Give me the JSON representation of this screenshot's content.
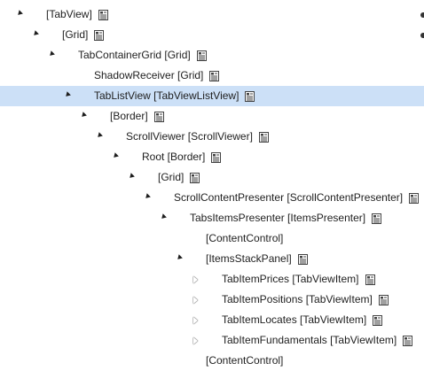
{
  "tree": {
    "nodes": [
      {
        "label": "[TabView]",
        "depth": 0,
        "expander": "expanded",
        "icon": "document-icon"
      },
      {
        "label": "[Grid]",
        "depth": 1,
        "expander": "expanded",
        "icon": "document-icon"
      },
      {
        "label": "TabContainerGrid [Grid]",
        "depth": 2,
        "expander": "expanded",
        "icon": "document-icon"
      },
      {
        "label": "ShadowReceiver [Grid]",
        "depth": 3,
        "expander": "none",
        "icon": "document-icon"
      },
      {
        "label": "TabListView [TabViewListView]",
        "depth": 3,
        "expander": "expanded",
        "icon": "document-icon",
        "selected": true
      },
      {
        "label": "[Border]",
        "depth": 4,
        "expander": "expanded",
        "icon": "document-icon"
      },
      {
        "label": "ScrollViewer [ScrollViewer]",
        "depth": 5,
        "expander": "expanded",
        "icon": "document-icon"
      },
      {
        "label": "Root [Border]",
        "depth": 6,
        "expander": "expanded",
        "icon": "document-icon"
      },
      {
        "label": "[Grid]",
        "depth": 7,
        "expander": "expanded",
        "icon": "document-icon"
      },
      {
        "label": "ScrollContentPresenter [ScrollContentPresenter]",
        "depth": 8,
        "expander": "expanded",
        "icon": "document-icon"
      },
      {
        "label": "TabsItemsPresenter [ItemsPresenter]",
        "depth": 9,
        "expander": "expanded",
        "icon": "document-icon"
      },
      {
        "label": "[ContentControl]",
        "depth": 10,
        "expander": "none",
        "icon": ""
      },
      {
        "label": "[ItemsStackPanel]",
        "depth": 10,
        "expander": "expanded",
        "icon": "document-icon"
      },
      {
        "label": "TabItemPrices [TabViewItem]",
        "depth": 11,
        "expander": "collapsed",
        "icon": "document-icon"
      },
      {
        "label": "TabItemPositions [TabViewItem]",
        "depth": 11,
        "expander": "collapsed",
        "icon": "document-icon"
      },
      {
        "label": "TabItemLocates [TabViewItem]",
        "depth": 11,
        "expander": "collapsed",
        "icon": "document-icon"
      },
      {
        "label": "TabItemFundamentals [TabViewItem]",
        "depth": 11,
        "expander": "collapsed",
        "icon": "document-icon"
      },
      {
        "label": "[ContentControl]",
        "depth": 10,
        "expander": "none",
        "icon": ""
      }
    ]
  },
  "colors": {
    "selected_row": "#cce0f7",
    "text": "#1e1e1e",
    "background": "#ffffff"
  }
}
